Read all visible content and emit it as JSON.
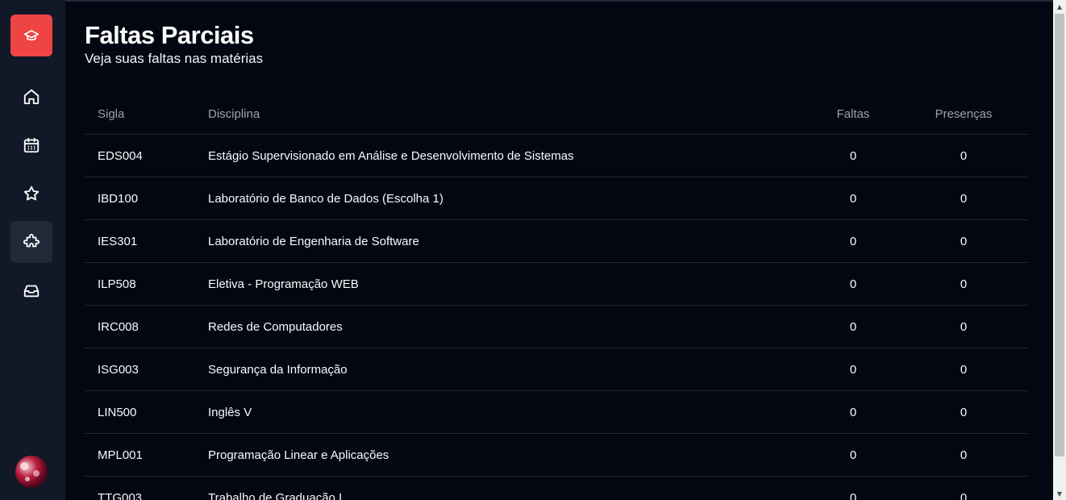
{
  "header": {
    "title": "Faltas Parciais",
    "subtitle": "Veja suas faltas nas matérias"
  },
  "sidebar": {
    "logo_icon": "graduation-cap-icon",
    "items": [
      {
        "icon": "home-icon",
        "active": false
      },
      {
        "icon": "calendar-icon",
        "active": false
      },
      {
        "icon": "star-icon",
        "active": false
      },
      {
        "icon": "puzzle-icon",
        "active": true
      },
      {
        "icon": "inbox-icon",
        "active": false
      }
    ],
    "accent_color": "#ef4444"
  },
  "table": {
    "columns": {
      "sigla": "Sigla",
      "disciplina": "Disciplina",
      "faltas": "Faltas",
      "presencas": "Presenças"
    },
    "rows": [
      {
        "sigla": "EDS004",
        "disciplina": "Estágio Supervisionado em Análise e Desenvolvimento de Sistemas",
        "faltas": "0",
        "presencas": "0"
      },
      {
        "sigla": "IBD100",
        "disciplina": "Laboratório de Banco de Dados (Escolha 1)",
        "faltas": "0",
        "presencas": "0"
      },
      {
        "sigla": "IES301",
        "disciplina": "Laboratório de Engenharia de Software",
        "faltas": "0",
        "presencas": "0"
      },
      {
        "sigla": "ILP508",
        "disciplina": "Eletiva - Programação WEB",
        "faltas": "0",
        "presencas": "0"
      },
      {
        "sigla": "IRC008",
        "disciplina": "Redes de Computadores",
        "faltas": "0",
        "presencas": "0"
      },
      {
        "sigla": "ISG003",
        "disciplina": "Segurança da Informação",
        "faltas": "0",
        "presencas": "0"
      },
      {
        "sigla": "LIN500",
        "disciplina": "Inglês V",
        "faltas": "0",
        "presencas": "0"
      },
      {
        "sigla": "MPL001",
        "disciplina": "Programação Linear e Aplicações",
        "faltas": "0",
        "presencas": "0"
      },
      {
        "sigla": "TTG003",
        "disciplina": "Trabalho de Graduação I",
        "faltas": "0",
        "presencas": "0"
      }
    ]
  }
}
